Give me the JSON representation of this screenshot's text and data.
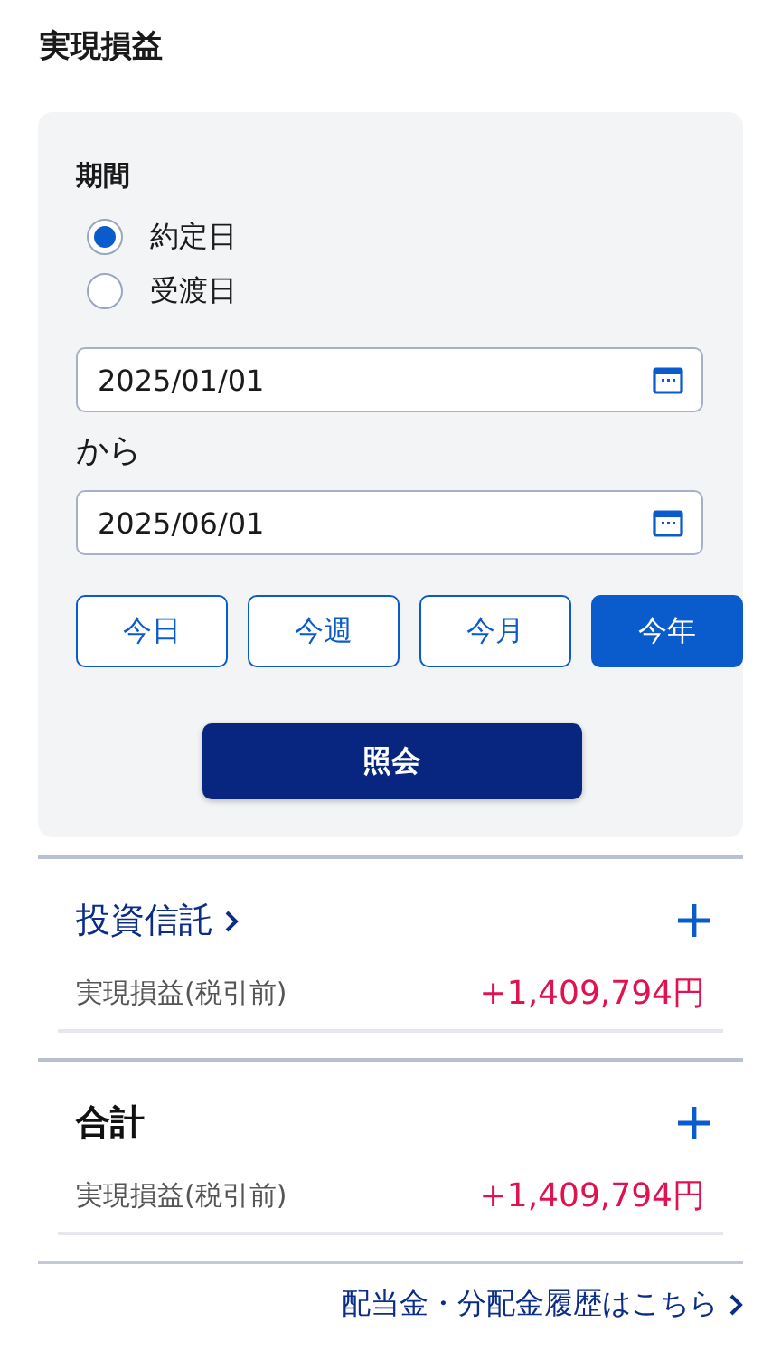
{
  "title": "実現損益",
  "filter": {
    "label": "期間",
    "radios": [
      {
        "label": "約定日",
        "selected": true
      },
      {
        "label": "受渡日",
        "selected": false
      }
    ],
    "from_date": "2025/01/01",
    "separator": "から",
    "to_date": "2025/06/01",
    "quick_ranges": [
      {
        "label": "今日",
        "selected": false
      },
      {
        "label": "今週",
        "selected": false
      },
      {
        "label": "今月",
        "selected": false
      },
      {
        "label": "今年",
        "selected": true
      }
    ],
    "submit": "照会"
  },
  "sections": [
    {
      "title": "投資信託",
      "kind": "link",
      "row_label": "実現損益(税引前)",
      "row_value": "+1,409,794円"
    },
    {
      "title": "合計",
      "kind": "plain",
      "row_label": "実現損益(税引前)",
      "row_value": "+1,409,794円"
    }
  ],
  "footer_link": "配当金・分配金履歴はこちら"
}
